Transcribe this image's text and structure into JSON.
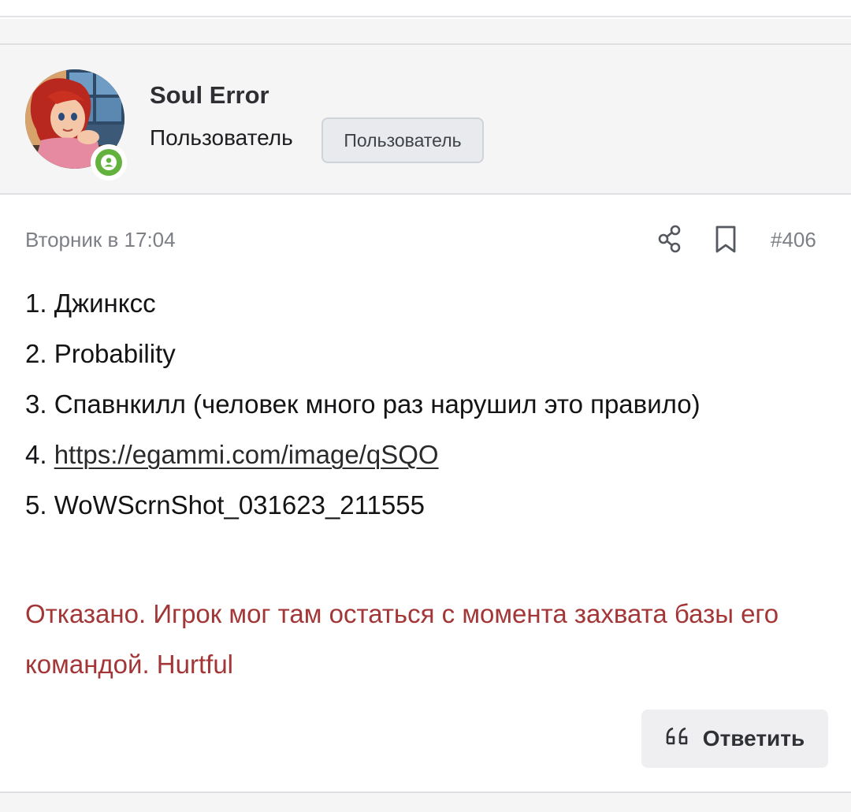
{
  "author": {
    "name": "Soul Error",
    "title": "Пользователь",
    "role_badge": "Пользователь",
    "avatar_icon": "avatar-image",
    "online_icon": "user-online-icon"
  },
  "post": {
    "date": "Вторник в 17:04",
    "number": "#406",
    "share_icon": "share-icon",
    "bookmark_icon": "bookmark-icon",
    "lines": [
      "1. Джинксс",
      "2. Probability",
      "3. Спавнкилл (человек много раз нарушил это правило)",
      {
        "prefix": "4. ",
        "link": "https://egammi.com/image/qSQO"
      },
      "5. WoWScrnShot_031623_211555"
    ],
    "moderator_note": "Отказано. Игрок мог там остаться с момента захвата базы его командой. Hurtful",
    "moderator_color": "#a33637"
  },
  "actions": {
    "reply_label": "Ответить",
    "reply_icon": "quote-icon"
  }
}
